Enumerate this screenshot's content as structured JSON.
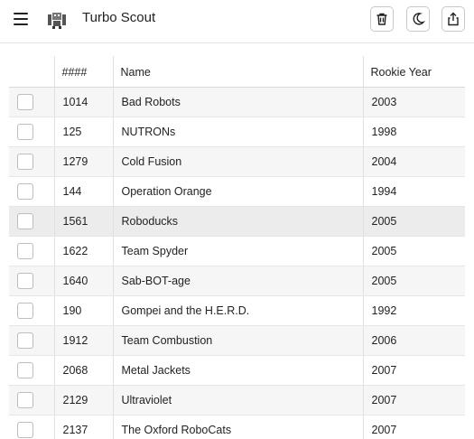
{
  "header": {
    "title": "Turbo Scout",
    "menu_icon": "hamburger-menu-icon",
    "logo_icon": "robot-logo-icon",
    "actions": [
      {
        "name": "delete-button",
        "icon": "trash-icon"
      },
      {
        "name": "dark-mode-button",
        "icon": "moon-icon"
      },
      {
        "name": "share-button",
        "icon": "share-icon"
      }
    ]
  },
  "table": {
    "columns": [
      "",
      "####",
      "Name",
      "Rookie Year"
    ],
    "rows": [
      {
        "number": "1014",
        "name": "Bad Robots",
        "rookie_year": "2003"
      },
      {
        "number": "125",
        "name": "NUTRONs",
        "rookie_year": "1998"
      },
      {
        "number": "1279",
        "name": "Cold Fusion",
        "rookie_year": "2004"
      },
      {
        "number": "144",
        "name": "Operation Orange",
        "rookie_year": "1994"
      },
      {
        "number": "1561",
        "name": "Roboducks",
        "rookie_year": "2005"
      },
      {
        "number": "1622",
        "name": "Team Spyder",
        "rookie_year": "2005"
      },
      {
        "number": "1640",
        "name": "Sab-BOT-age",
        "rookie_year": "2005"
      },
      {
        "number": "190",
        "name": "Gompei and the H.E.R.D.",
        "rookie_year": "1992"
      },
      {
        "number": "1912",
        "name": "Team Combustion",
        "rookie_year": "2006"
      },
      {
        "number": "2068",
        "name": "Metal Jackets",
        "rookie_year": "2007"
      },
      {
        "number": "2129",
        "name": "Ultraviolet",
        "rookie_year": "2007"
      },
      {
        "number": "2137",
        "name": "The Oxford RoboCats",
        "rookie_year": "2007"
      }
    ]
  }
}
